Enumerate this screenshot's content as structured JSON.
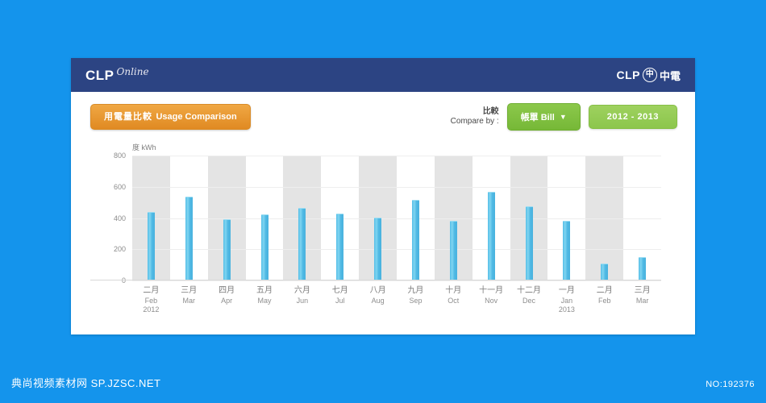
{
  "header": {
    "logo_left_main": "CLP",
    "logo_left_sub": "Online",
    "logo_right_main": "CLP",
    "logo_right_mark": "中",
    "logo_right_cn": "中電"
  },
  "toolbar": {
    "usage_button_zh": "用電量比較",
    "usage_button_en": "Usage Comparison",
    "compare_label_zh": "比較",
    "compare_label_en": "Compare by :",
    "compare_select_value": "帳單 Bill",
    "compare_select_caret": "▼",
    "period_button": "2012 - 2013"
  },
  "colors": {
    "page_background": "#1494ec",
    "titlebar": "#2c4483",
    "bar": "#4fb9e4",
    "band": "#e4e4e4",
    "orange_button": "#e08a22",
    "green_button": "#76b837",
    "green_button_pale": "#8cc64c"
  },
  "watermark": {
    "left": "典尚视频素材网  SP.JZSC.NET",
    "right": "NO:192376"
  },
  "chart_data": {
    "type": "bar",
    "title": "",
    "xlabel": "",
    "ylabel": "度 kWh",
    "ylim": [
      0,
      800
    ],
    "yticks": [
      0,
      200,
      400,
      600,
      800
    ],
    "grid": true,
    "legend": "none",
    "categories": [
      {
        "zh": "二月",
        "en": "Feb",
        "year": "2012"
      },
      {
        "zh": "三月",
        "en": "Mar",
        "year": ""
      },
      {
        "zh": "四月",
        "en": "Apr",
        "year": ""
      },
      {
        "zh": "五月",
        "en": "May",
        "year": ""
      },
      {
        "zh": "六月",
        "en": "Jun",
        "year": ""
      },
      {
        "zh": "七月",
        "en": "Jul",
        "year": ""
      },
      {
        "zh": "八月",
        "en": "Aug",
        "year": ""
      },
      {
        "zh": "九月",
        "en": "Sep",
        "year": ""
      },
      {
        "zh": "十月",
        "en": "Oct",
        "year": ""
      },
      {
        "zh": "十一月",
        "en": "Nov",
        "year": ""
      },
      {
        "zh": "十二月",
        "en": "Dec",
        "year": ""
      },
      {
        "zh": "一月",
        "en": "Jan",
        "year": "2013"
      },
      {
        "zh": "二月",
        "en": "Feb",
        "year": ""
      },
      {
        "zh": "三月",
        "en": "Mar",
        "year": ""
      }
    ],
    "values": [
      435,
      530,
      388,
      420,
      458,
      423,
      400,
      510,
      375,
      565,
      470,
      375,
      105,
      145
    ],
    "series": [
      {
        "name": "kWh",
        "values": [
          435,
          530,
          388,
          420,
          458,
          423,
          400,
          510,
          375,
          565,
          470,
          375,
          105,
          145
        ]
      }
    ]
  }
}
